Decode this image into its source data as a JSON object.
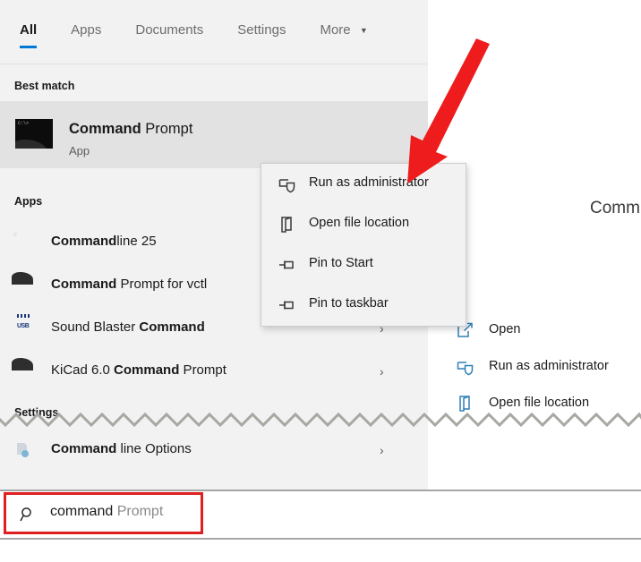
{
  "window": {
    "kind": "windows-search-results"
  },
  "tabs": [
    {
      "label": "All",
      "active": true
    },
    {
      "label": "Apps",
      "active": false
    },
    {
      "label": "Documents",
      "active": false
    },
    {
      "label": "Settings",
      "active": false
    },
    {
      "label": "More",
      "active": false,
      "caret": "▼"
    }
  ],
  "sections": {
    "best_match": "Best match",
    "apps": "Apps",
    "settings": "Settings"
  },
  "best_match": {
    "title_bold": "Command",
    "title_rest": " Prompt",
    "subtitle": "App",
    "icon": "console-icon",
    "icon_glyph": "C:\\>"
  },
  "apps": [
    {
      "bold": "Command",
      "rest": "line 25",
      "bold_first": true,
      "icon": "sphere-icon",
      "chevron": ""
    },
    {
      "bold": "Command",
      "rest": " Prompt for vctl",
      "bold_first": true,
      "icon": "console-icon",
      "chevron": ""
    },
    {
      "pre": "Sound Blaster ",
      "bold": "Command",
      "rest": "",
      "bold_first": false,
      "icon": "sound-blaster-icon",
      "chevron": "›"
    },
    {
      "pre": "KiCad 6.0 ",
      "bold": "Command",
      "rest": " Prompt",
      "bold_first": false,
      "icon": "console-icon",
      "chevron": "›"
    }
  ],
  "settings_items": [
    {
      "bold": "Command",
      "rest": " line Options",
      "icon": "settings-options-icon",
      "chevron": "›"
    }
  ],
  "context_menu": [
    {
      "label": "Run as administrator",
      "icon": "shield-icon"
    },
    {
      "label": "Open file location",
      "icon": "folder-icon"
    },
    {
      "label": "Pin to Start",
      "icon": "pin-icon"
    },
    {
      "label": "Pin to taskbar",
      "icon": "pin-icon"
    }
  ],
  "right_menu": [
    {
      "label": "Open",
      "icon": "open-external-icon"
    },
    {
      "label": "Run as administrator",
      "icon": "shield-icon"
    },
    {
      "label": "Open file location",
      "icon": "folder-icon"
    }
  ],
  "preview": {
    "title": "Comm"
  },
  "search": {
    "typed": "command",
    "suggestion": " Prompt",
    "icon": "search-icon"
  },
  "annotations": {
    "arrow": "red-arrow-pointing-to-run-as-administrator",
    "arrow_color": "#ee1c1c",
    "highlight_box": "red-rectangle-around-search-box",
    "highlight_color": "#e02020",
    "tear_line": "gray-zigzag-cut-line"
  },
  "colors": {
    "accent": "#0078d4",
    "panel_bg": "#f2f2f2",
    "selected_row": "#e2e2e2",
    "menu_icon_blue": "#2f7fb5",
    "text": "#1a1a1a",
    "muted_text": "#6d6d6d"
  }
}
